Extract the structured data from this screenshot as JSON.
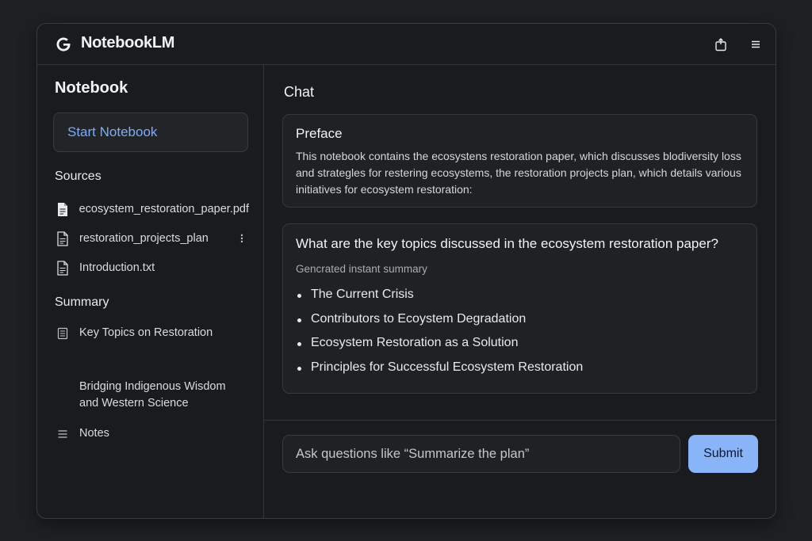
{
  "app": {
    "name": "NotebookLM",
    "logo_letter": "G"
  },
  "toolbar": {
    "icons": [
      "share-icon",
      "menu-icon"
    ]
  },
  "sidebar": {
    "title": "Notebook",
    "start_button": "Start Notebook",
    "sources_heading": "Sources",
    "sources": [
      {
        "label": "ecosystem_restoration_paper.pdf",
        "icon": "document-filled-icon"
      },
      {
        "label": "restoration_projects_plan",
        "icon": "document-icon"
      },
      {
        "label": "Introduction.txt",
        "icon": "document-icon"
      }
    ],
    "summary_heading": "Summary",
    "summary_items": [
      {
        "label": "Key Topics on Restoration",
        "icon": "note-icon"
      },
      {
        "label": "Bridging Indigenous Wisdom and Western Science",
        "icon": ""
      },
      {
        "label": "Notes",
        "icon": "list-icon"
      }
    ]
  },
  "chat": {
    "title": "Chat",
    "preface": {
      "heading": "Preface",
      "body": "This notebook contains the ecosystens restoration paper,  which discusses blodiversity loss and strategles for restering ecosystems, the restoration projects plan, which details various initiatives for ecosystem restoration:"
    },
    "response": {
      "question": "What are the key topics discussed in the ecosystem restoration paper?",
      "generated_label": "Gencrated instant summary",
      "topics": [
        "The Current Crisis",
        "Contributors to Ecoystem Degradation",
        "Ecosystem Restoration as a Solution",
        "Principles for Successful Ecosystem Restoration"
      ]
    },
    "input": {
      "placeholder": "Ask questions like “Summarize the plan”",
      "value": ""
    },
    "submit_label": "Submit"
  },
  "colors": {
    "accent": "#8ab4f8",
    "link": "#7cacf8",
    "background": "#1a1b1e",
    "card": "#202124"
  }
}
